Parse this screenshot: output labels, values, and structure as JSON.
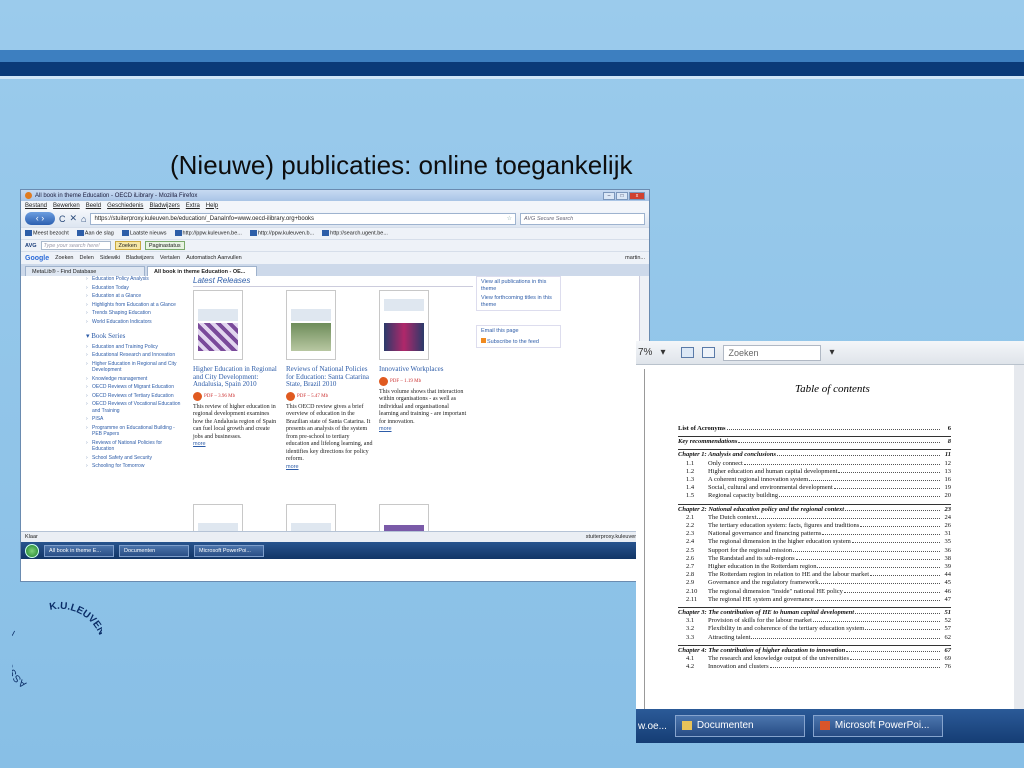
{
  "slide": {
    "title": "(Nieuwe) publicaties: online toegankelijk",
    "logo_text_arc1": "ASSOCIATIE",
    "logo_text_arc2": "K.U.LEUVEN"
  },
  "browser": {
    "window_title": "All book in theme Education - OECD iLibrary - Mozilla Firefox",
    "menu": [
      "Bestand",
      "Bewerken",
      "Beeld",
      "Geschiedenis",
      "Bladwijzers",
      "Extra",
      "Help"
    ],
    "url": "https://stuiterproxy.kuleuven.be/education/_DanaInfo=www.oecd-ilibrary.org+books",
    "search_placeholder": "AVG Secure Search",
    "bookmarks": [
      "Meest bezocht",
      "Aan de slag",
      "Laatste nieuws",
      "http://ppw.kuleuven.be...",
      "http://ppw.kuleuven.b...",
      "http://search.ugent.be..."
    ],
    "avg": {
      "logo": "AVG",
      "search_placeholder": "Type your search here!",
      "search_button": "Zoeken",
      "status_button": "Paginastatus"
    },
    "google": {
      "logo": "Google",
      "items": [
        "Zoeken",
        "Delen",
        "Sidewiki",
        "Bladwijzers",
        "Vertalen",
        "Automatisch Aanvullen"
      ],
      "user": "martin..."
    },
    "tabs": [
      "MetaLib® - Find Database",
      "All book in theme Education - OE..."
    ],
    "leftnav_top": [
      "Education Policy Analysis",
      "Education Today",
      "Education at a Glance",
      "Highlights from Education at a Glance",
      "Trends Shaping Education",
      "World Education Indicators"
    ],
    "leftnav_header": "Book Series",
    "leftnav_series": [
      "Education and Training Policy",
      "Educational Research and Innovation",
      "Higher Education in Regional and City Development",
      "Knowledge management",
      "OECD Reviews of Migrant Education",
      "OECD Reviews of Tertiary Education",
      "OECD Reviews of Vocational Education and Training",
      "PISA",
      "Programme on Educational Building - PEB Papers",
      "Reviews of National Policies for Education",
      "School Safety and Security",
      "Schooling for Tomorrow"
    ],
    "latest_header": "Latest Releases",
    "books": [
      {
        "title": "Higher Education in Regional and City Development: Andalusia, Spain 2010",
        "pdf": "PDF – 3.96 Mb",
        "desc": "This review of higher education in regional development examines how the Andalusia region of Spain can fuel local growth and create jobs and businesses.",
        "more": "more"
      },
      {
        "title": "Reviews of National Policies for Education: Santa Catarina State, Brazil 2010",
        "pdf": "PDF – 5.47 Mb",
        "desc": "This OECD review gives a brief overview of education in the Brazilian state of Santa Catarina. It presents an analysis of the system from pre-school to tertiary education and lifelong learning, and identifies key directions for policy reform.",
        "more": "more"
      },
      {
        "title": "Innovative Workplaces",
        "pdf": "PDF – 1.19 Mb",
        "desc": "This volume shows that interaction within organisations - as well as individual and organisational learning and training - are important for innovation.",
        "more": "more"
      }
    ],
    "right_links": [
      "View all publications in this theme",
      "View forthcoming titles in this theme"
    ],
    "right_actions": [
      "Email this page",
      "Subscribe to the feed"
    ],
    "status_left": "Klaar",
    "status_right": "stuiterproxy.kuleuven.be",
    "taskbar": [
      "All book in theme E...",
      "Documenten",
      "Microsoft PowerPoi..."
    ]
  },
  "docviewer": {
    "zoom": "7%",
    "search_placeholder": "Zoeken",
    "toc_title": "Table of contents",
    "toc": [
      {
        "type": "plain",
        "label": "List of Acronyms",
        "page": "6"
      },
      {
        "type": "chap",
        "label": "Key recommendations",
        "page": "8"
      },
      {
        "type": "chap",
        "label": "Chapter 1: Analysis and conclusions",
        "page": "11"
      },
      {
        "type": "item",
        "num": "1.1",
        "label": "Only connect",
        "page": "12"
      },
      {
        "type": "item",
        "num": "1.2",
        "label": "Higher education and human capital development",
        "page": "13"
      },
      {
        "type": "item",
        "num": "1.3",
        "label": "A coherent regional innovation system",
        "page": "16"
      },
      {
        "type": "item",
        "num": "1.4",
        "label": "Social, cultural and environmental development",
        "page": "19"
      },
      {
        "type": "item",
        "num": "1.5",
        "label": "Regional capacity building",
        "page": "20"
      },
      {
        "type": "chap",
        "label": "Chapter 2: National education policy and the regional context",
        "page": "23"
      },
      {
        "type": "item",
        "num": "2.1",
        "label": "The Dutch context",
        "page": "24"
      },
      {
        "type": "item",
        "num": "2.2",
        "label": "The tertiary education system: facts, figures and traditions",
        "page": "26"
      },
      {
        "type": "item",
        "num": "2.3",
        "label": "National governance and financing patterns",
        "page": "31"
      },
      {
        "type": "item",
        "num": "2.4",
        "label": "The regional dimension in the higher education system",
        "page": "35"
      },
      {
        "type": "item",
        "num": "2.5",
        "label": "Support for the regional mission",
        "page": "36"
      },
      {
        "type": "item",
        "num": "2.6",
        "label": "The Randstad and its sub-regions",
        "page": "38"
      },
      {
        "type": "item",
        "num": "2.7",
        "label": "Higher education in the Rotterdam region",
        "page": "39"
      },
      {
        "type": "item",
        "num": "2.8",
        "label": "The Rotterdam region in relation to HE and the labour market",
        "page": "44"
      },
      {
        "type": "item",
        "num": "2.9",
        "label": "Governance and the regulatory framework",
        "page": "45"
      },
      {
        "type": "item",
        "num": "2.10",
        "label": "The regional dimension \"inside\" national HE policy",
        "page": "46"
      },
      {
        "type": "item",
        "num": "2.11",
        "label": "The regional HE system and governance",
        "page": "47"
      },
      {
        "type": "chap",
        "label": "Chapter 3: The contribution of HE to human capital development",
        "page": "51"
      },
      {
        "type": "item",
        "num": "3.1",
        "label": "Provision of skills for the labour market",
        "page": "52"
      },
      {
        "type": "item",
        "num": "3.2",
        "label": "Flexibility in and coherence of the tertiary education system",
        "page": "57"
      },
      {
        "type": "item",
        "num": "3.3",
        "label": "Attracting talent",
        "page": "62"
      },
      {
        "type": "chap",
        "label": "Chapter 4: The contribution of higher education to innovation",
        "page": "67"
      },
      {
        "type": "item",
        "num": "4.1",
        "label": "The research and knowledge output of the universities",
        "page": "69"
      },
      {
        "type": "item",
        "num": "4.2",
        "label": "Innovation and clusters",
        "page": "76"
      }
    ],
    "taskbar": [
      "w.oe...",
      "Documenten",
      "Microsoft PowerPoi..."
    ]
  }
}
